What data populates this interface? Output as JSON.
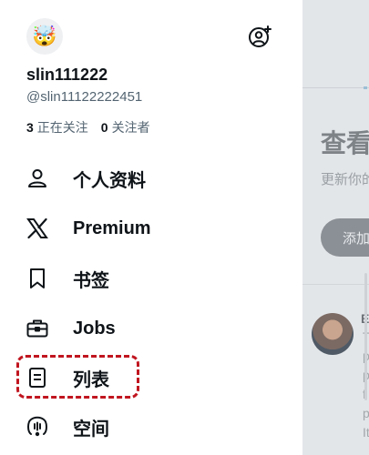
{
  "underlay": {
    "heading": "查看",
    "subtitle": "更新你的",
    "add_button": "添加",
    "post_author_initial": "E",
    "post_text_chars": [
      "T",
      "p",
      "p",
      "f",
      "p",
      "t"
    ],
    "post_text_tail": "It"
  },
  "profile": {
    "avatar_icon": "exploding-head-emoji",
    "avatar_glyph": "🤯",
    "display_name": "slin111222",
    "handle": "@slin11122222451",
    "following_count": "3",
    "following_label": "正在关注",
    "followers_count": "0",
    "followers_label": "关注者"
  },
  "menu": [
    {
      "label": "个人资料",
      "icon": "person-icon"
    },
    {
      "label": "Premium",
      "icon": "x-logo-icon"
    },
    {
      "label": "书签",
      "icon": "bookmark-icon"
    },
    {
      "label": "Jobs",
      "icon": "briefcase-icon"
    },
    {
      "label": "列表",
      "icon": "list-icon"
    },
    {
      "label": "空间",
      "icon": "spaces-icon"
    }
  ],
  "colors": {
    "highlight": "#c0151f",
    "text": "#0f1419",
    "secondary_text": "#536471"
  }
}
